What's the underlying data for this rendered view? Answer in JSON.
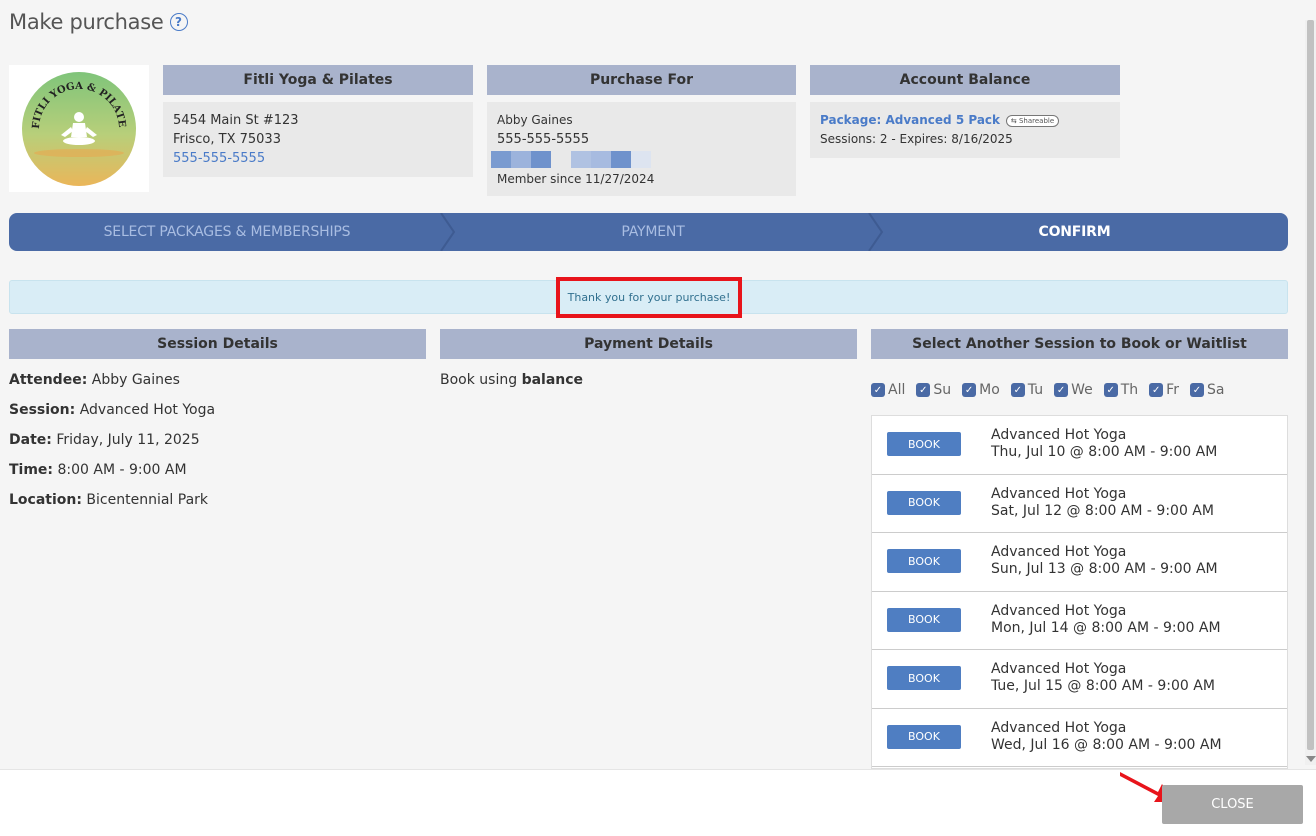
{
  "header": {
    "title": "Make purchase"
  },
  "studio": {
    "name": "Fitli Yoga & Pilates",
    "address_line1": "5454 Main St #123",
    "address_line2": "Frisco, TX 75033",
    "phone": "555-555-5555",
    "logo_text": "FITLI YOGA & PILATES"
  },
  "purchase_for": {
    "title": "Purchase For",
    "name": "Abby Gaines",
    "phone": "555-555-5555",
    "member_since": "Member since 11/27/2024"
  },
  "account": {
    "title": "Account Balance",
    "package": "Package: Advanced 5 Pack",
    "badge": "Shareable",
    "sessions": "Sessions: 2 - Expires: 8/16/2025"
  },
  "steps": [
    {
      "label": "SELECT PACKAGES & MEMBERSHIPS"
    },
    {
      "label": "PAYMENT"
    },
    {
      "label": "CONFIRM"
    }
  ],
  "alert": {
    "message": "Thank you for your purchase!"
  },
  "session_details": {
    "title": "Session Details",
    "rows": [
      {
        "label": "Attendee:",
        "value": "Abby Gaines"
      },
      {
        "label": "Session:",
        "value": "Advanced Hot Yoga"
      },
      {
        "label": "Date:",
        "value": "Friday, July 11, 2025"
      },
      {
        "label": "Time:",
        "value": "8:00 AM - 9:00 AM"
      },
      {
        "label": "Location:",
        "value": "Bicentennial Park"
      }
    ]
  },
  "payment_details": {
    "title": "Payment Details",
    "prefix": "Book using",
    "method": "balance"
  },
  "another_session": {
    "title": "Select Another Session to Book or Waitlist",
    "days": [
      "All",
      "Su",
      "Mo",
      "Tu",
      "We",
      "Th",
      "Fr",
      "Sa"
    ],
    "book_label": "BOOK",
    "sessions": [
      {
        "name": "Advanced Hot Yoga",
        "when": "Thu, Jul 10 @ 8:00 AM - 9:00 AM"
      },
      {
        "name": "Advanced Hot Yoga",
        "when": "Sat, Jul 12 @ 8:00 AM - 9:00 AM"
      },
      {
        "name": "Advanced Hot Yoga",
        "when": "Sun, Jul 13 @ 8:00 AM - 9:00 AM"
      },
      {
        "name": "Advanced Hot Yoga",
        "when": "Mon, Jul 14 @ 8:00 AM - 9:00 AM"
      },
      {
        "name": "Advanced Hot Yoga",
        "when": "Tue, Jul 15 @ 8:00 AM - 9:00 AM"
      },
      {
        "name": "Advanced Hot Yoga",
        "when": "Wed, Jul 16 @ 8:00 AM - 9:00 AM"
      }
    ]
  },
  "footer": {
    "close_label": "CLOSE"
  }
}
